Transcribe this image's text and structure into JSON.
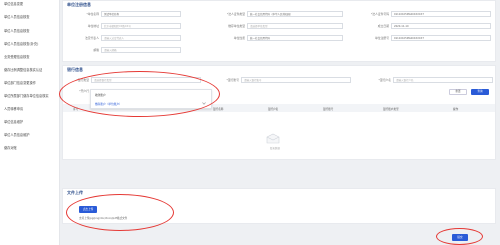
{
  "sidebar": {
    "items": [
      {
        "label": "单位信息变更"
      },
      {
        "label": "单位人员信息核查"
      },
      {
        "label": "单位人员信息核查"
      },
      {
        "label": "单位人员信息核查(补充)"
      },
      {
        "label": "业务受理信息核查"
      },
      {
        "label": "缴存比例调整信息核实认证"
      },
      {
        "label": "单位部门信息变更操作"
      },
      {
        "label": "单位所属部门缴存单位信息核实"
      },
      {
        "label": "人员转移申请"
      },
      {
        "label": "单位信息维护"
      },
      {
        "label": "单位人员信息维护"
      },
      {
        "label": "缴存对账"
      }
    ]
  },
  "unit_section": {
    "title": "单位注册信息",
    "fields": {
      "unit_name": {
        "label": "*单位名称",
        "value": "测试单位名称"
      },
      "cert_type": {
        "label": "*法人证件类型",
        "value": "统一社会信用代码（中华人民共和国）"
      },
      "cert_no": {
        "label": "*法人证件号码",
        "value": "91110105MA00XXXXX7"
      },
      "unit_address": {
        "label": "单位地址",
        "value": "北京市朝阳区XX路XX号"
      },
      "org_type": {
        "label": "缴存单位类型",
        "value": "请选择单位类型"
      },
      "est_date": {
        "label": "成立日期",
        "value": "2020-11-10"
      },
      "legal_rep": {
        "label": "法定代表人",
        "value": "请输入法定代表人"
      },
      "unit_nature": {
        "label": "单位性质",
        "value": "统一社会信用代码"
      },
      "reg_no": {
        "label": "单位注册号",
        "value": "91110105MA00XXXXX7"
      },
      "email": {
        "label": "邮箱",
        "value": "请输入邮箱"
      }
    }
  },
  "bank_section": {
    "title": "银行信息",
    "bank_type_label": "*银行类型",
    "bank_type_placeholder": "请选择银行类型",
    "account_no_label": "*银行账号",
    "account_no_placeholder": "请输入银行账号",
    "account_name_label": "*银行户名",
    "account_name_placeholder": "请输入银行户名",
    "open_bank_label": "*开户行",
    "dropdown_options": [
      {
        "label": "收款账户"
      },
      {
        "label": "缴存账户（单位账户）"
      }
    ],
    "reset_label": "重置",
    "query_label": "查询",
    "table_headers": [
      "序号",
      "银行名称",
      "银行户名",
      "银行账号",
      "银行账户类型",
      "操作"
    ],
    "empty_text": "暂无数据"
  },
  "upload_section": {
    "title": "文件上传",
    "upload_button": "点击上传",
    "hint": "支持上传jpg/png/doc/docx/pdf格式文件"
  },
  "footer": {
    "submit_label": "提交"
  },
  "colors": {
    "accent": "#2a5bd7",
    "annotation_red": "#e53935"
  }
}
